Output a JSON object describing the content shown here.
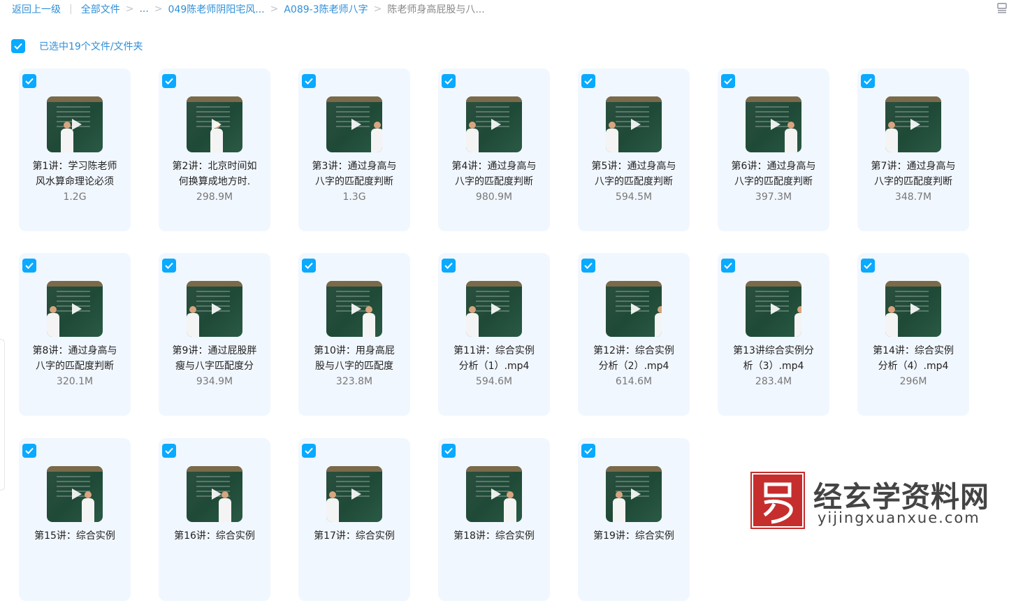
{
  "breadcrumb": {
    "back": "返回上一级",
    "all_files": "全部文件",
    "ellipsis": "...",
    "folder1": "049陈老师阴阳宅风...",
    "folder2": "A089-3陈老师八字",
    "current": "陈老师身高屁股与八..."
  },
  "selection": {
    "text": "已选中19个文件/文件夹",
    "checked": true
  },
  "files": [
    {
      "name_line1": "第1讲：学习陈老师",
      "name_line2": "风水算命理论必须",
      "size": "1.2G"
    },
    {
      "name_line1": "第2讲：北京时间如",
      "name_line2": "何换算成地方时.",
      "size": "298.9M"
    },
    {
      "name_line1": "第3讲：通过身高与",
      "name_line2": "八字的匹配度判断",
      "size": "1.3G"
    },
    {
      "name_line1": "第4讲：通过身高与",
      "name_line2": "八字的匹配度判断",
      "size": "980.9M"
    },
    {
      "name_line1": "第5讲：通过身高与",
      "name_line2": "八字的匹配度判断",
      "size": "594.5M"
    },
    {
      "name_line1": "第6讲：通过身高与",
      "name_line2": "八字的匹配度判断",
      "size": "397.3M"
    },
    {
      "name_line1": "第7讲：通过身高与",
      "name_line2": "八字的匹配度判断",
      "size": "348.7M"
    },
    {
      "name_line1": "第8讲：通过身高与",
      "name_line2": "八字的匹配度判断",
      "size": "320.1M"
    },
    {
      "name_line1": "第9讲：通过屁股胖",
      "name_line2": "瘦与八字匹配度分",
      "size": "934.9M"
    },
    {
      "name_line1": "第10讲：用身高屁",
      "name_line2": "股与八字的匹配度",
      "size": "323.8M"
    },
    {
      "name_line1": "第11讲：综合实例",
      "name_line2": "分析（1）.mp4",
      "size": "594.6M"
    },
    {
      "name_line1": "第12讲：综合实例",
      "name_line2": "分析（2）.mp4",
      "size": "614.6M"
    },
    {
      "name_line1": "第13讲综合实例分",
      "name_line2": "析（3）.mp4",
      "size": "283.4M"
    },
    {
      "name_line1": "第14讲：综合实例",
      "name_line2": "分析（4）.mp4",
      "size": "296M"
    },
    {
      "name_line1": "第15讲：综合实例",
      "name_line2": "",
      "size": ""
    },
    {
      "name_line1": "第16讲：综合实例",
      "name_line2": "",
      "size": ""
    },
    {
      "name_line1": "第17讲：综合实例",
      "name_line2": "",
      "size": ""
    },
    {
      "name_line1": "第18讲：综合实例",
      "name_line2": "",
      "size": ""
    },
    {
      "name_line1": "第19讲：综合实例",
      "name_line2": "",
      "size": ""
    }
  ],
  "watermark": {
    "title": "经玄学资料网",
    "domain": "yijingxuanxue.com"
  },
  "icons": {
    "checkbox": "check-icon",
    "view_toggle": "list-view-icon",
    "play": "play-icon"
  },
  "colors": {
    "accent": "#09aaff",
    "link": "#2f8fd8",
    "card_bg": "#f1f7fe"
  }
}
